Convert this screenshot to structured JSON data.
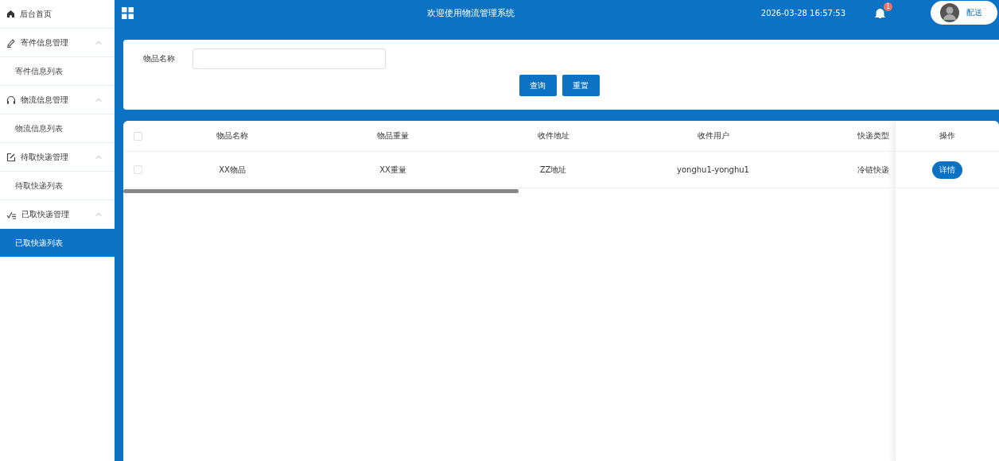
{
  "sidebar": {
    "items": [
      {
        "kind": "link",
        "label": "后台首页",
        "selected": false
      },
      {
        "kind": "group",
        "label": "寄件信息管理",
        "expanded": true,
        "children": [
          {
            "label": "寄件信息列表",
            "selected": false
          }
        ]
      },
      {
        "kind": "group",
        "label": "物流信息管理",
        "expanded": true,
        "children": [
          {
            "label": "物流信息列表",
            "selected": false
          }
        ]
      },
      {
        "kind": "group",
        "label": "待取快递管理",
        "expanded": true,
        "children": [
          {
            "label": "待取快递列表",
            "selected": false
          }
        ]
      },
      {
        "kind": "group",
        "label": "已取快递管理",
        "expanded": true,
        "children": [
          {
            "label": "已取快递列表",
            "selected": true
          }
        ]
      }
    ]
  },
  "header": {
    "title": "欢迎使用物流管理系统",
    "datetime": "2026-03-28 16:57:53",
    "notification_count": "1",
    "user": "配送"
  },
  "search": {
    "field_label": "物品名称",
    "buttons": [
      "查询",
      "重置"
    ]
  },
  "table": {
    "all_checked": false,
    "columns": [
      "物品名称",
      "物品重量",
      "收件地址",
      "收件用户",
      "快递类型"
    ],
    "action_column": "操作",
    "rows": [
      {
        "checked": false,
        "cells": [
          "XX物品",
          "XX重量",
          "ZZ地址",
          "yonghu1-yonghu1",
          "冷链快递"
        ],
        "action": "详情"
      }
    ]
  }
}
